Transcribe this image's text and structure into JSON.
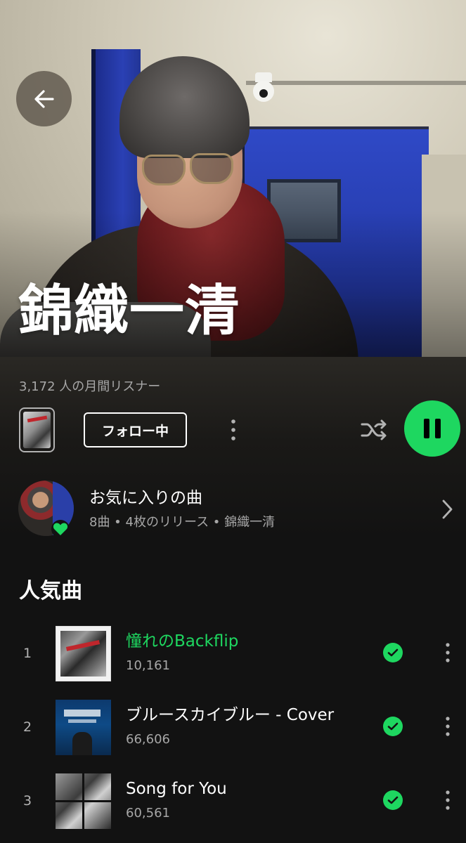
{
  "artist": {
    "name": "錦織一清",
    "monthly_listeners": "3,172 人の月間リスナー"
  },
  "controls": {
    "follow_label": "フォロー中"
  },
  "liked_songs": {
    "title": "お気に入りの曲",
    "subtitle": "8曲 • 4枚のリリース • 錦織一清"
  },
  "popular": {
    "heading": "人気曲",
    "tracks": [
      {
        "rank": "1",
        "title": "憧れのBackflip",
        "plays": "10,161",
        "playing": true
      },
      {
        "rank": "2",
        "title": "ブルースカイブルー - Cover",
        "plays": "66,606",
        "playing": false
      },
      {
        "rank": "3",
        "title": "Song for You",
        "plays": "60,561",
        "playing": false
      }
    ]
  },
  "icons": {
    "back": "arrow-left-icon",
    "more": "more-vertical-icon",
    "shuffle": "shuffle-icon",
    "pause": "pause-icon",
    "liked_heart": "heart-icon",
    "chevron": "chevron-right-icon",
    "downloaded": "check-circle-icon"
  },
  "colors": {
    "accent": "#1ed760",
    "background": "#121212",
    "secondary_text": "#a7a7a7"
  }
}
